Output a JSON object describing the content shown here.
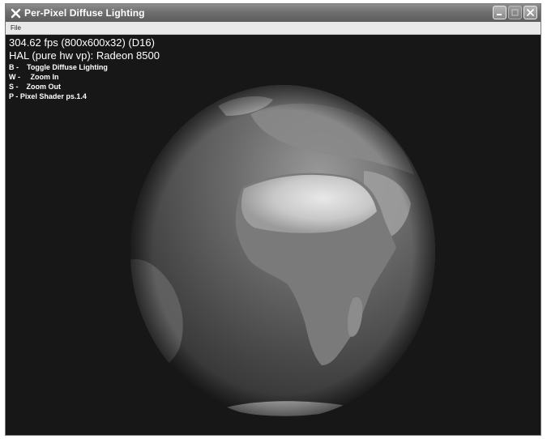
{
  "window": {
    "title": "Per-Pixel Diffuse Lighting",
    "app_icon": "dx-logo-icon",
    "controls": [
      "minimize-icon",
      "maximize-icon",
      "close-icon"
    ]
  },
  "menu": {
    "items": [
      "File"
    ]
  },
  "stats": {
    "fps_line": "304.62 fps (800x600x32) (D16)",
    "device_line": "HAL (pure hw vp): Radeon 8500"
  },
  "help": [
    "B -    Toggle Diffuse Lighting",
    "W -     Zoom In",
    "S -    Zoom Out",
    "P - Pixel Shader ps.1.4"
  ],
  "colors": {
    "background": "#171717",
    "titlebar": "#6f6f6f",
    "text": "#ffffff"
  }
}
